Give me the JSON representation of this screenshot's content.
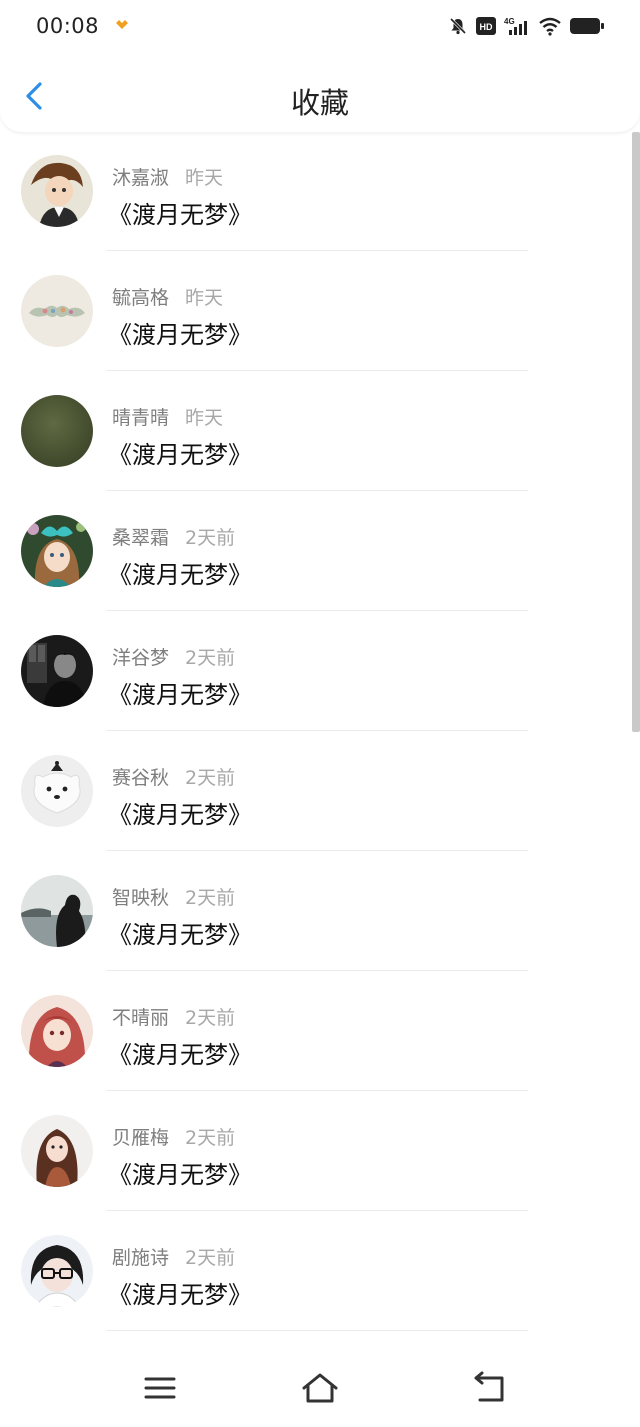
{
  "status": {
    "time": "00:08"
  },
  "header": {
    "title": "收藏"
  },
  "items": [
    {
      "name": "沐嘉淑",
      "time": "昨天",
      "title": "《渡月无梦》",
      "avatar": "anime-boy"
    },
    {
      "name": "毓高格",
      "time": "昨天",
      "title": "《渡月无梦》",
      "avatar": "mustache"
    },
    {
      "name": "晴青晴",
      "time": "昨天",
      "title": "《渡月无梦》",
      "avatar": "olive-circle"
    },
    {
      "name": "桑翠霜",
      "time": "2天前",
      "title": "《渡月无梦》",
      "avatar": "girl-teal-bow"
    },
    {
      "name": "洋谷梦",
      "time": "2天前",
      "title": "《渡月无梦》",
      "avatar": "dark-portrait"
    },
    {
      "name": "赛谷秋",
      "time": "2天前",
      "title": "《渡月无梦》",
      "avatar": "white-dog"
    },
    {
      "name": "智映秋",
      "time": "2天前",
      "title": "《渡月无梦》",
      "avatar": "silhouette-lake"
    },
    {
      "name": "不晴丽",
      "time": "2天前",
      "title": "《渡月无梦》",
      "avatar": "anime-girl-red"
    },
    {
      "name": "贝雁梅",
      "time": "2天前",
      "title": "《渡月无梦》",
      "avatar": "woman-long-hair"
    },
    {
      "name": "剧施诗",
      "time": "2天前",
      "title": "《渡月无梦》",
      "avatar": "glasses-girl"
    }
  ],
  "colors": {
    "accent": "#2d8ee8",
    "text": "#111111",
    "meta": "#8a8a8a"
  }
}
